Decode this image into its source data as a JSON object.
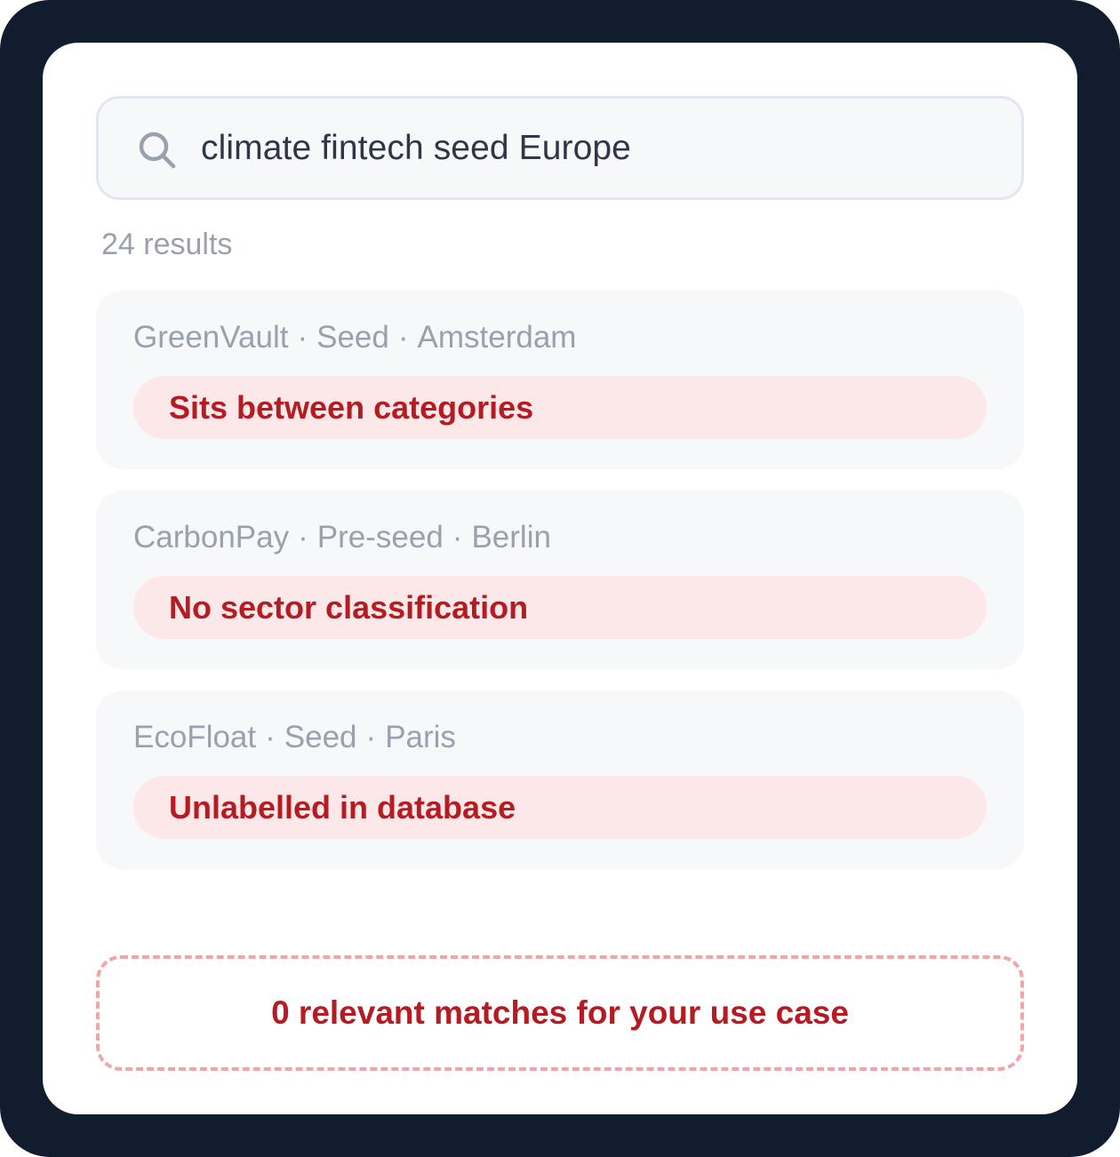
{
  "search": {
    "icon": "search-icon",
    "query": "climate fintech seed Europe"
  },
  "results_count": "24 results",
  "separator": "·",
  "results": [
    {
      "name": "GreenVault",
      "stage": "Seed",
      "city": "Amsterdam",
      "tag": "Sits between categories"
    },
    {
      "name": "CarbonPay",
      "stage": "Pre-seed",
      "city": "Berlin",
      "tag": "No sector classification"
    },
    {
      "name": "EcoFloat",
      "stage": "Seed",
      "city": "Paris",
      "tag": "Unlabelled in database"
    }
  ],
  "summary": "0 relevant matches for your use case",
  "colors": {
    "frame": "#111c2f",
    "tag_background": "#fce8e9",
    "accent_red": "#b51b22",
    "dashed_border": "#f3a4a7"
  }
}
